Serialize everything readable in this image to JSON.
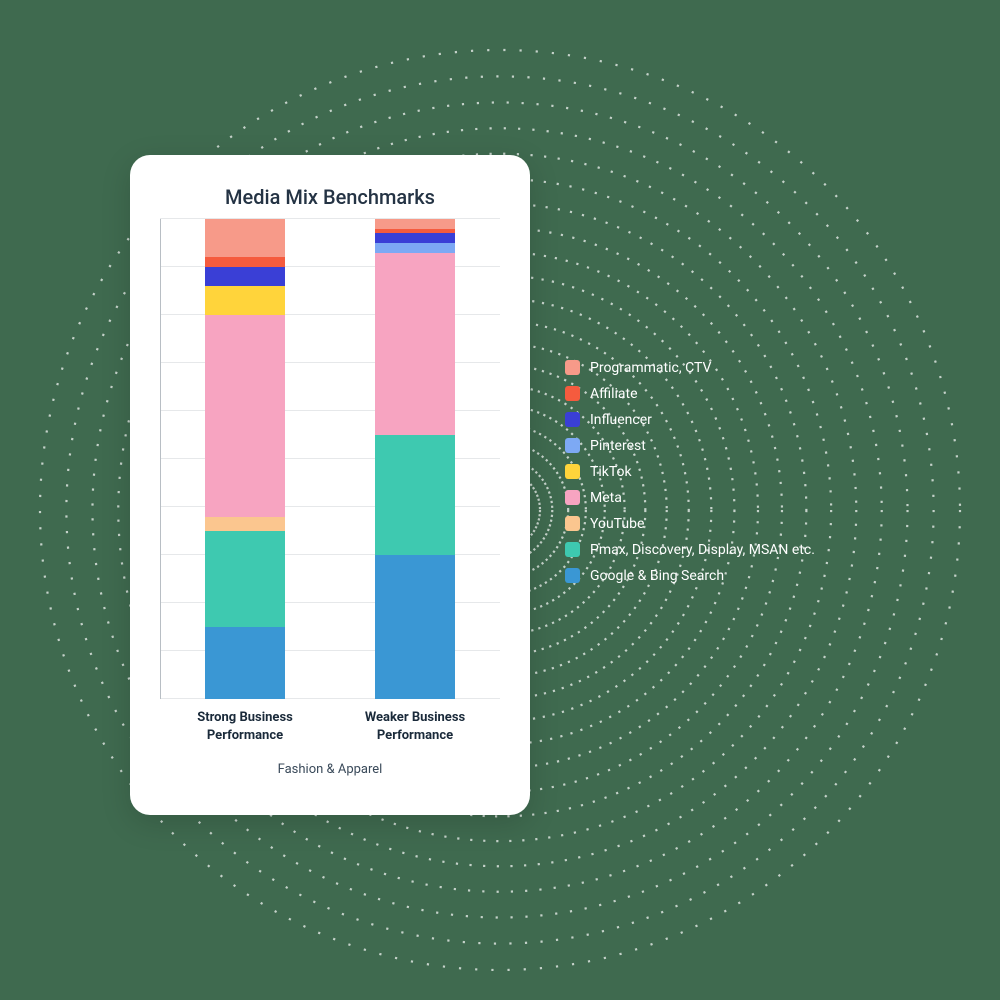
{
  "card": {
    "title": "Media Mix Benchmarks",
    "subtitle": "Fashion & Apparel"
  },
  "legend": [
    {
      "name": "Programmatic, CTV",
      "color": "#f79a89"
    },
    {
      "name": "Affiliate",
      "color": "#f55b3e"
    },
    {
      "name": "Influencer",
      "color": "#3a3fd6"
    },
    {
      "name": "Pinterest",
      "color": "#7da9f4"
    },
    {
      "name": "TikTok",
      "color": "#ffd43b"
    },
    {
      "name": "Meta",
      "color": "#f7a4c1"
    },
    {
      "name": "YouTube",
      "color": "#fbc68f"
    },
    {
      "name": "Pmax, Discovery, Display, MSAN etc.",
      "color": "#3ec9b0"
    },
    {
      "name": "Google & Bing Search",
      "color": "#3a97d4"
    }
  ],
  "chart_data": {
    "type": "bar",
    "stacked": true,
    "title": "Media Mix Benchmarks",
    "subtitle": "Fashion & Apparel",
    "xlabel": "",
    "ylabel": "",
    "ylim": [
      0,
      100
    ],
    "grid": true,
    "legend_position": "right",
    "categories": [
      "Strong Business Performance",
      "Weaker Business Performance"
    ],
    "series": [
      {
        "name": "Google & Bing Search",
        "color": "#3a97d4",
        "values": [
          15,
          30
        ]
      },
      {
        "name": "Pmax, Discovery, Display, MSAN etc.",
        "color": "#3ec9b0",
        "values": [
          20,
          25
        ]
      },
      {
        "name": "YouTube",
        "color": "#fbc68f",
        "values": [
          3,
          0
        ]
      },
      {
        "name": "Meta",
        "color": "#f7a4c1",
        "values": [
          42,
          38
        ]
      },
      {
        "name": "TikTok",
        "color": "#ffd43b",
        "values": [
          6,
          0
        ]
      },
      {
        "name": "Pinterest",
        "color": "#7da9f4",
        "values": [
          0,
          2
        ]
      },
      {
        "name": "Influencer",
        "color": "#3a3fd6",
        "values": [
          4,
          2
        ]
      },
      {
        "name": "Affiliate",
        "color": "#f55b3e",
        "values": [
          2,
          1
        ]
      },
      {
        "name": "Programmatic, CTV",
        "color": "#f79a89",
        "values": [
          8,
          2
        ]
      }
    ]
  }
}
